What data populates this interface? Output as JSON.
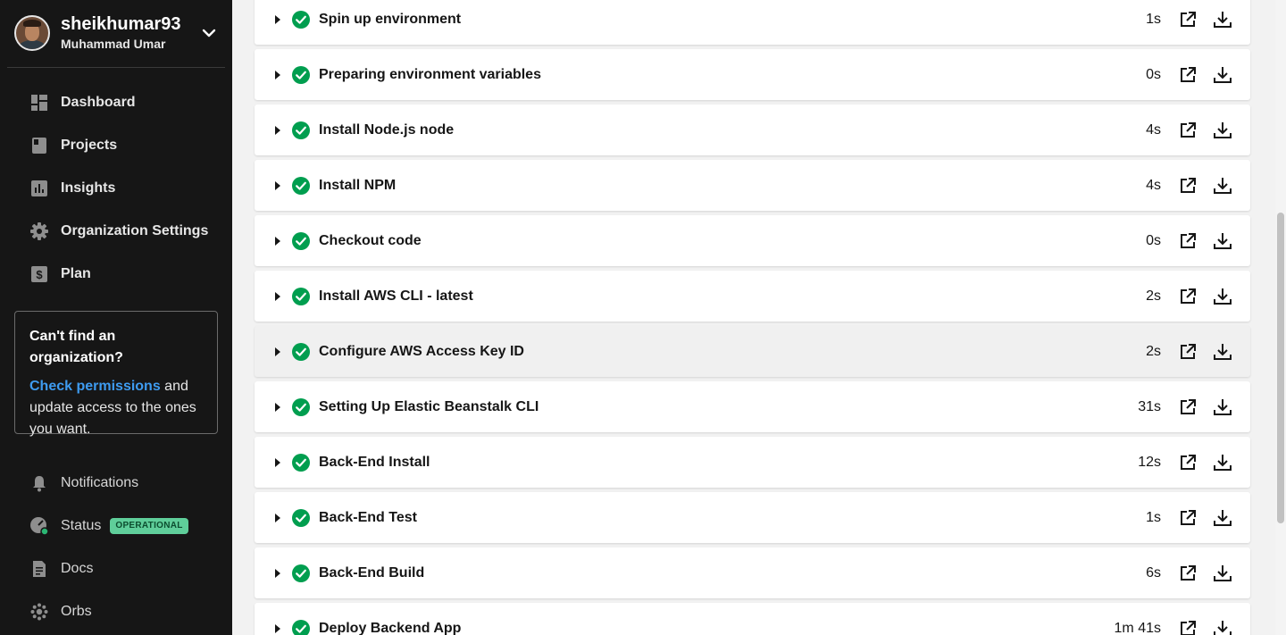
{
  "user": {
    "username": "sheikhumar93",
    "full_name": "Muhammad Umar"
  },
  "nav": [
    {
      "label": "Dashboard",
      "icon": "dashboard-icon"
    },
    {
      "label": "Projects",
      "icon": "projects-icon"
    },
    {
      "label": "Insights",
      "icon": "insights-icon"
    },
    {
      "label": "Organization Settings",
      "icon": "gear-icon"
    },
    {
      "label": "Plan",
      "icon": "dollar-icon"
    }
  ],
  "notice": {
    "title": "Can't find an organization?",
    "link": "Check permissions",
    "body": " and update access to the ones you want."
  },
  "bottom_nav": [
    {
      "label": "Notifications",
      "icon": "bell-icon"
    },
    {
      "label": "Status",
      "icon": "status-icon",
      "badge": "OPERATIONAL"
    },
    {
      "label": "Docs",
      "icon": "docs-icon"
    },
    {
      "label": "Orbs",
      "icon": "orbs-icon"
    }
  ],
  "steps": [
    {
      "name": "Spin up environment",
      "time": "1s"
    },
    {
      "name": "Preparing environment variables",
      "time": "0s"
    },
    {
      "name": "Install Node.js node",
      "time": "4s"
    },
    {
      "name": "Install NPM",
      "time": "4s"
    },
    {
      "name": "Checkout code",
      "time": "0s"
    },
    {
      "name": "Install AWS CLI - latest",
      "time": "2s"
    },
    {
      "name": "Configure AWS Access Key ID",
      "time": "2s"
    },
    {
      "name": "Setting Up Elastic Beanstalk CLI",
      "time": "31s"
    },
    {
      "name": "Back-End Install",
      "time": "12s"
    },
    {
      "name": "Back-End Test",
      "time": "1s"
    },
    {
      "name": "Back-End Build",
      "time": "6s"
    },
    {
      "name": "Deploy Backend App",
      "time": "1m 41s"
    }
  ],
  "colors": {
    "sidebar": "#161616",
    "success": "#009e4f",
    "link": "#3e9bf0",
    "badge": "#5fce9a"
  }
}
